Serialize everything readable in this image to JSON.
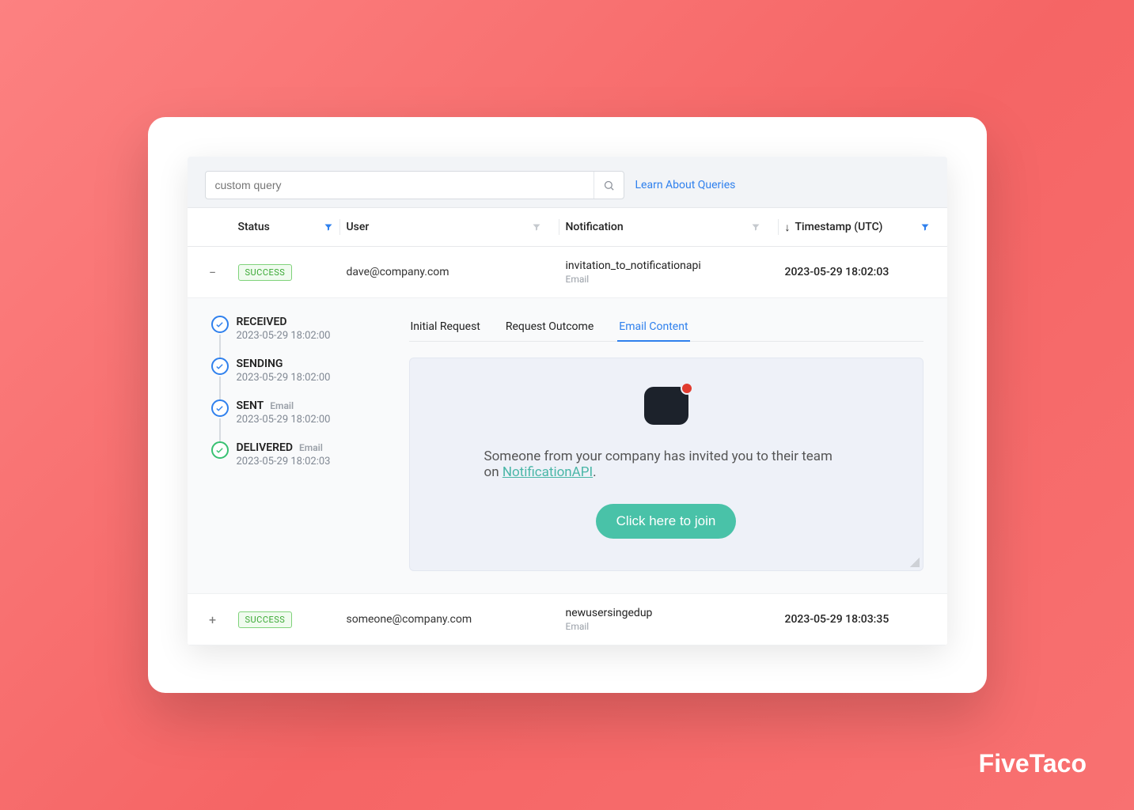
{
  "brand": "FiveTaco",
  "header": {
    "search_placeholder": "custom query",
    "learn_link": "Learn About Queries"
  },
  "columns": {
    "status": "Status",
    "user": "User",
    "notification": "Notification",
    "timestamp": "Timestamp (UTC)",
    "sort_indicator": "↓"
  },
  "rows": [
    {
      "expanded": true,
      "status_badge": "SUCCESS",
      "user": "dave@company.com",
      "notification_name": "invitation_to_notificationapi",
      "notification_channel": "Email",
      "timestamp": "2023-05-29 18:02:03"
    },
    {
      "expanded": false,
      "status_badge": "SUCCESS",
      "user": "someone@company.com",
      "notification_name": "newusersingedup",
      "notification_channel": "Email",
      "timestamp": "2023-05-29 18:03:35"
    }
  ],
  "timeline": [
    {
      "label": "RECEIVED",
      "sub": "",
      "ts": "2023-05-29 18:02:00",
      "color": "blue"
    },
    {
      "label": "SENDING",
      "sub": "",
      "ts": "2023-05-29 18:02:00",
      "color": "blue"
    },
    {
      "label": "SENT",
      "sub": "Email",
      "ts": "2023-05-29 18:02:00",
      "color": "blue"
    },
    {
      "label": "DELIVERED",
      "sub": "Email",
      "ts": "2023-05-29 18:02:03",
      "color": "green"
    }
  ],
  "tabs": {
    "initial_request": "Initial Request",
    "request_outcome": "Request Outcome",
    "email_content": "Email Content",
    "active": "email_content"
  },
  "email": {
    "body_prefix": "Someone from your company has invited you to their team on ",
    "link_text": "NotificationAPI",
    "body_suffix": ".",
    "cta": "Click here to join"
  }
}
